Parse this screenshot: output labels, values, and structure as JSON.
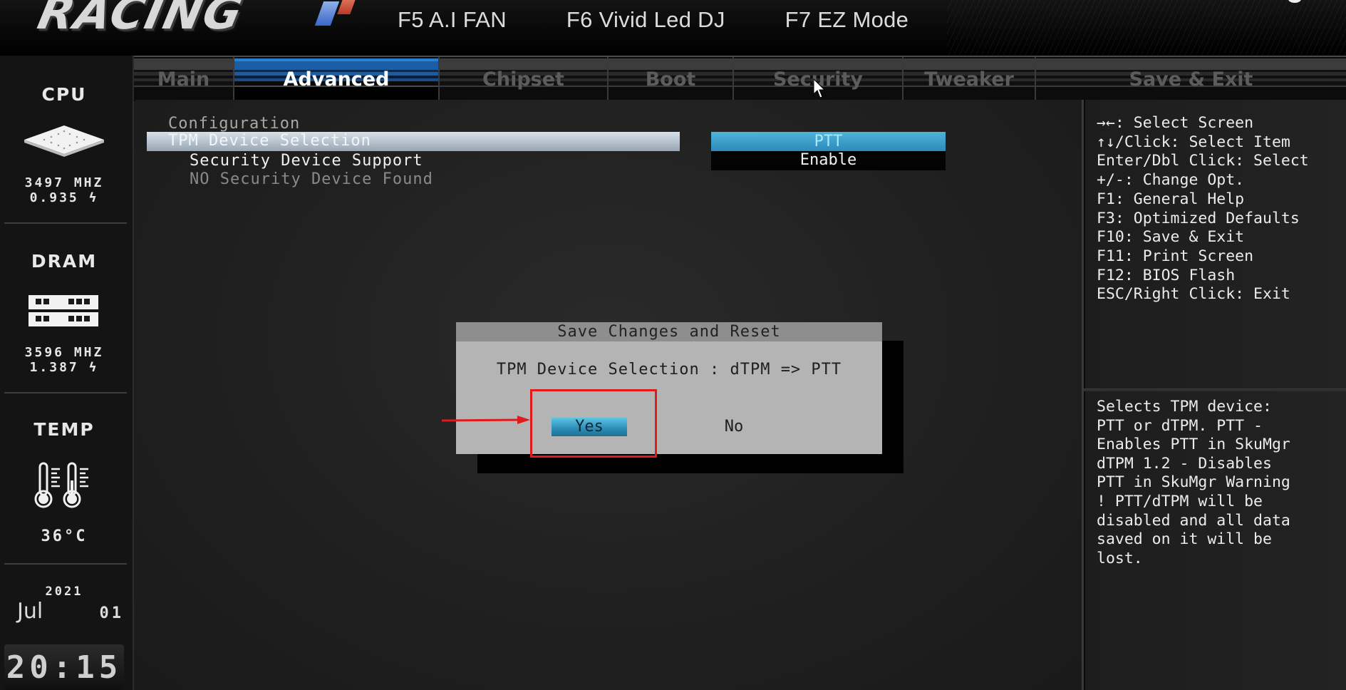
{
  "header": {
    "logo_text": "RACING",
    "hotkeys": [
      "F5 A.I FAN",
      "F6 Vivid Led DJ",
      "F7 EZ Mode"
    ]
  },
  "tabs": [
    {
      "label": "Main",
      "active": false
    },
    {
      "label": "Advanced",
      "active": true
    },
    {
      "label": "Chipset",
      "active": false
    },
    {
      "label": "Boot",
      "active": false
    },
    {
      "label": "Security",
      "active": false
    },
    {
      "label": "Tweaker",
      "active": false
    },
    {
      "label": "Save & Exit",
      "active": false
    }
  ],
  "sidebar": {
    "cpu": {
      "label": "CPU",
      "freq": "3497 MHZ",
      "voltage": "0.935 ϟ"
    },
    "dram": {
      "label": "DRAM",
      "freq": "3596 MHZ",
      "voltage": "1.387 ϟ"
    },
    "temp": {
      "label": "TEMP",
      "value": "36°C"
    },
    "date": {
      "year": "2021",
      "month": "Jul",
      "day": "01"
    },
    "time": "20:15"
  },
  "main": {
    "section_title": "Configuration",
    "items": [
      {
        "label": "TPM Device Selection",
        "value": "PTT",
        "selected": true
      },
      {
        "label": "Security Device Support",
        "value": "Enable",
        "selected": false
      },
      {
        "label": "NO Security Device Found",
        "value": null,
        "disabled": true
      }
    ]
  },
  "help": {
    "keys": [
      "→←: Select Screen",
      "↑↓/Click: Select Item",
      "Enter/Dbl Click: Select",
      "+/-: Change Opt.",
      "F1: General Help",
      "F3: Optimized Defaults",
      "F10: Save & Exit",
      "F11: Print Screen",
      "F12: BIOS Flash",
      "ESC/Right Click: Exit"
    ],
    "description": "Selects TPM device:\nPTT or dTPM. PTT -\nEnables PTT in SkuMgr\ndTPM 1.2 - Disables\nPTT in SkuMgr Warning\n!  PTT/dTPM will be\ndisabled and all data\nsaved on it will be\nlost."
  },
  "dialog": {
    "title": "Save Changes and Reset",
    "message": "TPM Device Selection : dTPM => PTT",
    "yes_label": "Yes",
    "no_label": "No"
  },
  "colors": {
    "accent": "#2c8ab8",
    "highlight": "#b8c4ce",
    "annotation": "#e0191a"
  }
}
